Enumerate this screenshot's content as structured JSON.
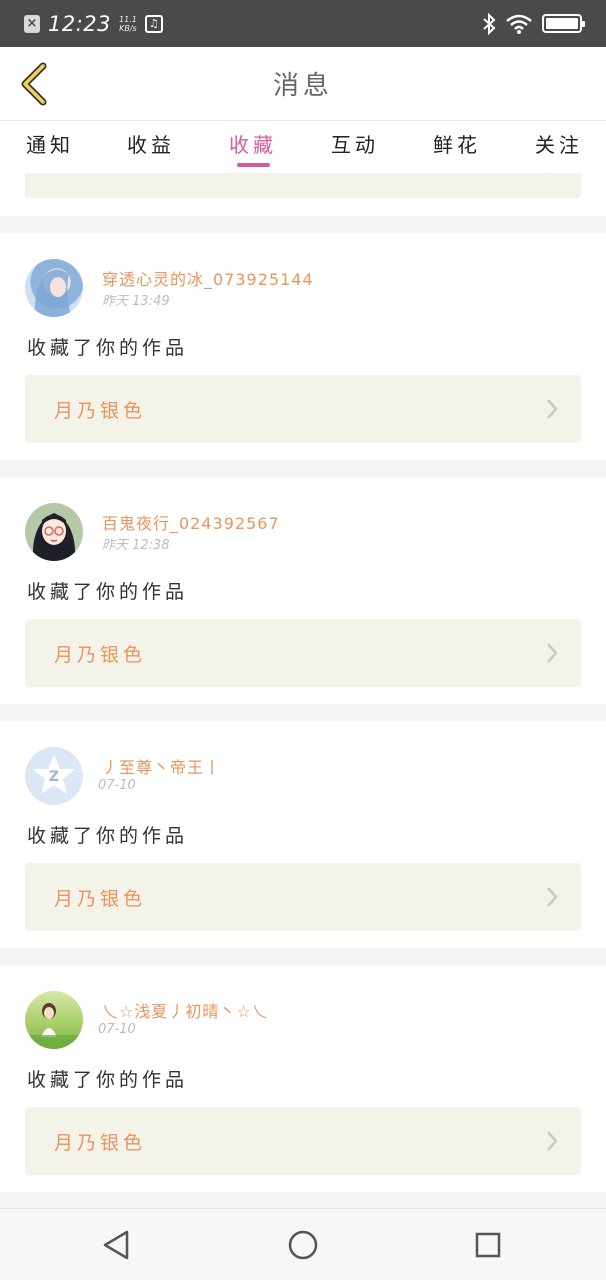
{
  "status_bar": {
    "time": "12:23",
    "speed_value": "11.1",
    "speed_unit": "KB/s"
  },
  "header": {
    "title": "消息"
  },
  "tabs": [
    {
      "label": "通知",
      "active": false
    },
    {
      "label": "收益",
      "active": false
    },
    {
      "label": "收藏",
      "active": true
    },
    {
      "label": "互动",
      "active": false
    },
    {
      "label": "鲜花",
      "active": false
    },
    {
      "label": "关注",
      "active": false
    }
  ],
  "messages": [
    {
      "username": "穿透心灵的冰_073925144",
      "time": "昨天 13:49",
      "action": "收藏了你的作品",
      "work_title": "月乃银色",
      "avatar": "blue-hair-girl"
    },
    {
      "username": "百鬼夜行_024392567",
      "time": "昨天 12:38",
      "action": "收藏了你的作品",
      "work_title": "月乃银色",
      "avatar": "glasses-girl"
    },
    {
      "username": "丿至尊丶帝王丨",
      "time": "07-10",
      "action": "收藏了你的作品",
      "work_title": "月乃银色",
      "avatar": "default-z-avatar"
    },
    {
      "username": "乀☆浅夏丿初晴丶☆乀",
      "time": "07-10",
      "action": "收藏了你的作品",
      "work_title": "月乃银色",
      "avatar": "girl-on-grass"
    }
  ],
  "colors": {
    "accent_pink": "#d75a9b",
    "name_orange": "#e8955e",
    "work_bg": "#f3f3ea",
    "status_bar": "#4a4a4a"
  }
}
